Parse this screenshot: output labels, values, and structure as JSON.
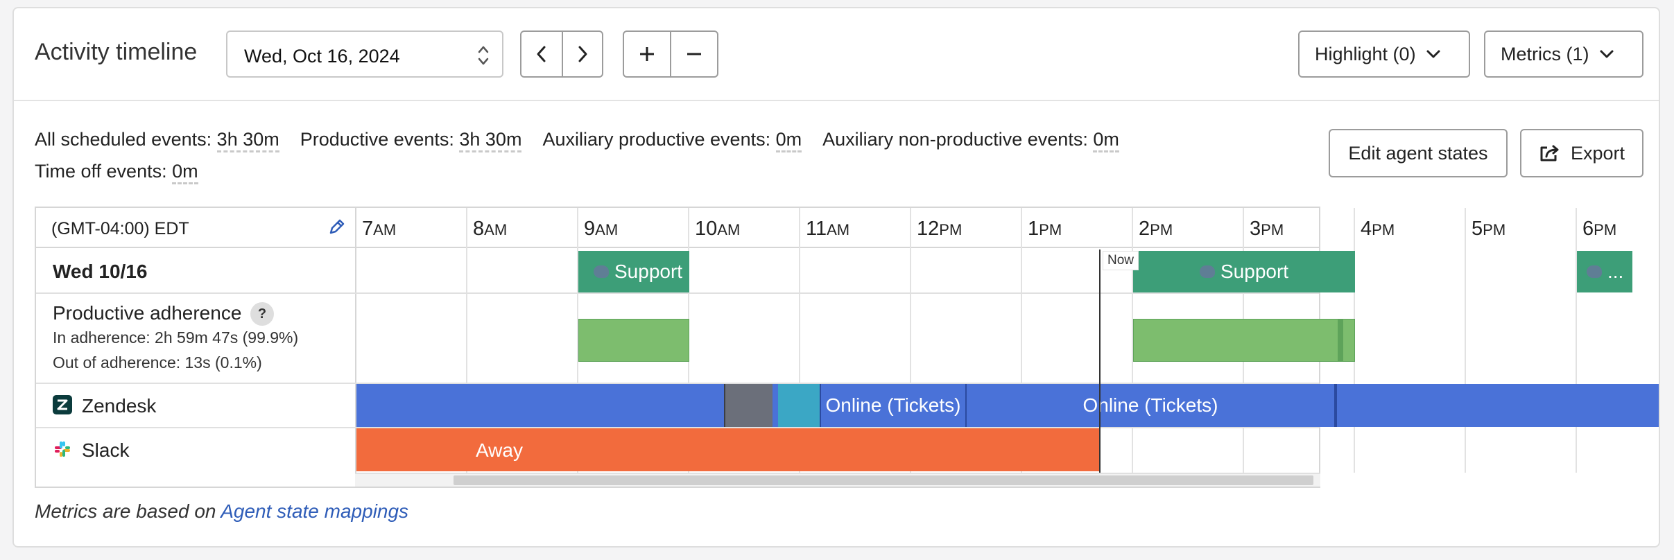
{
  "header": {
    "title": "Activity timeline",
    "date_value": "Wed, Oct 16, 2024",
    "highlight_label": "Highlight (0)",
    "metrics_label": "Metrics (1)"
  },
  "summary": {
    "all_scheduled_label": "All scheduled events:",
    "all_scheduled_value": "3h 30m",
    "productive_label": "Productive events:",
    "productive_value": "3h 30m",
    "aux_productive_label": "Auxiliary productive events:",
    "aux_productive_value": "0m",
    "aux_nonproductive_label": "Auxiliary non-productive events:",
    "aux_nonproductive_value": "0m",
    "time_off_label": "Time off events:",
    "time_off_value": "0m"
  },
  "actions": {
    "edit_agent_states": "Edit agent states",
    "export": "Export"
  },
  "timeline": {
    "timezone": "(GMT-04:00) EDT",
    "hours": [
      {
        "num": "7",
        "ampm": "AM"
      },
      {
        "num": "8",
        "ampm": "AM"
      },
      {
        "num": "9",
        "ampm": "AM"
      },
      {
        "num": "10",
        "ampm": "AM"
      },
      {
        "num": "11",
        "ampm": "AM"
      },
      {
        "num": "12",
        "ampm": "PM"
      },
      {
        "num": "1",
        "ampm": "PM"
      },
      {
        "num": "2",
        "ampm": "PM"
      },
      {
        "num": "3",
        "ampm": "PM"
      },
      {
        "num": "4",
        "ampm": "PM"
      },
      {
        "num": "5",
        "ampm": "PM"
      },
      {
        "num": "6",
        "ampm": "PM"
      }
    ],
    "now_label": "Now",
    "rows": {
      "date_label": "Wed 10/16",
      "adherence_label": "Productive adherence",
      "in_adherence": "In adherence: 2h 59m 47s  (99.9%)",
      "out_adherence": "Out of adherence: 13s  (0.1%)",
      "zendesk_label": "Zendesk",
      "slack_label": "Slack"
    },
    "events": {
      "support_1": "Support",
      "support_2": "Support",
      "support_3": "..."
    },
    "zendesk_states": {
      "online_tickets_1": "Online (Tickets)",
      "online_tickets_2": "Online (Tickets)"
    },
    "slack_states": {
      "away": "Away"
    }
  },
  "footer": {
    "prefix": "Metrics are based on",
    "link": "Agent state mappings"
  },
  "colors": {
    "event_green": "#3d9e78",
    "adherence_green": "#7dbd6e",
    "zendesk_blue": "#4a72d8",
    "slack_orange": "#f26b3d",
    "link_blue": "#2f5db8"
  }
}
